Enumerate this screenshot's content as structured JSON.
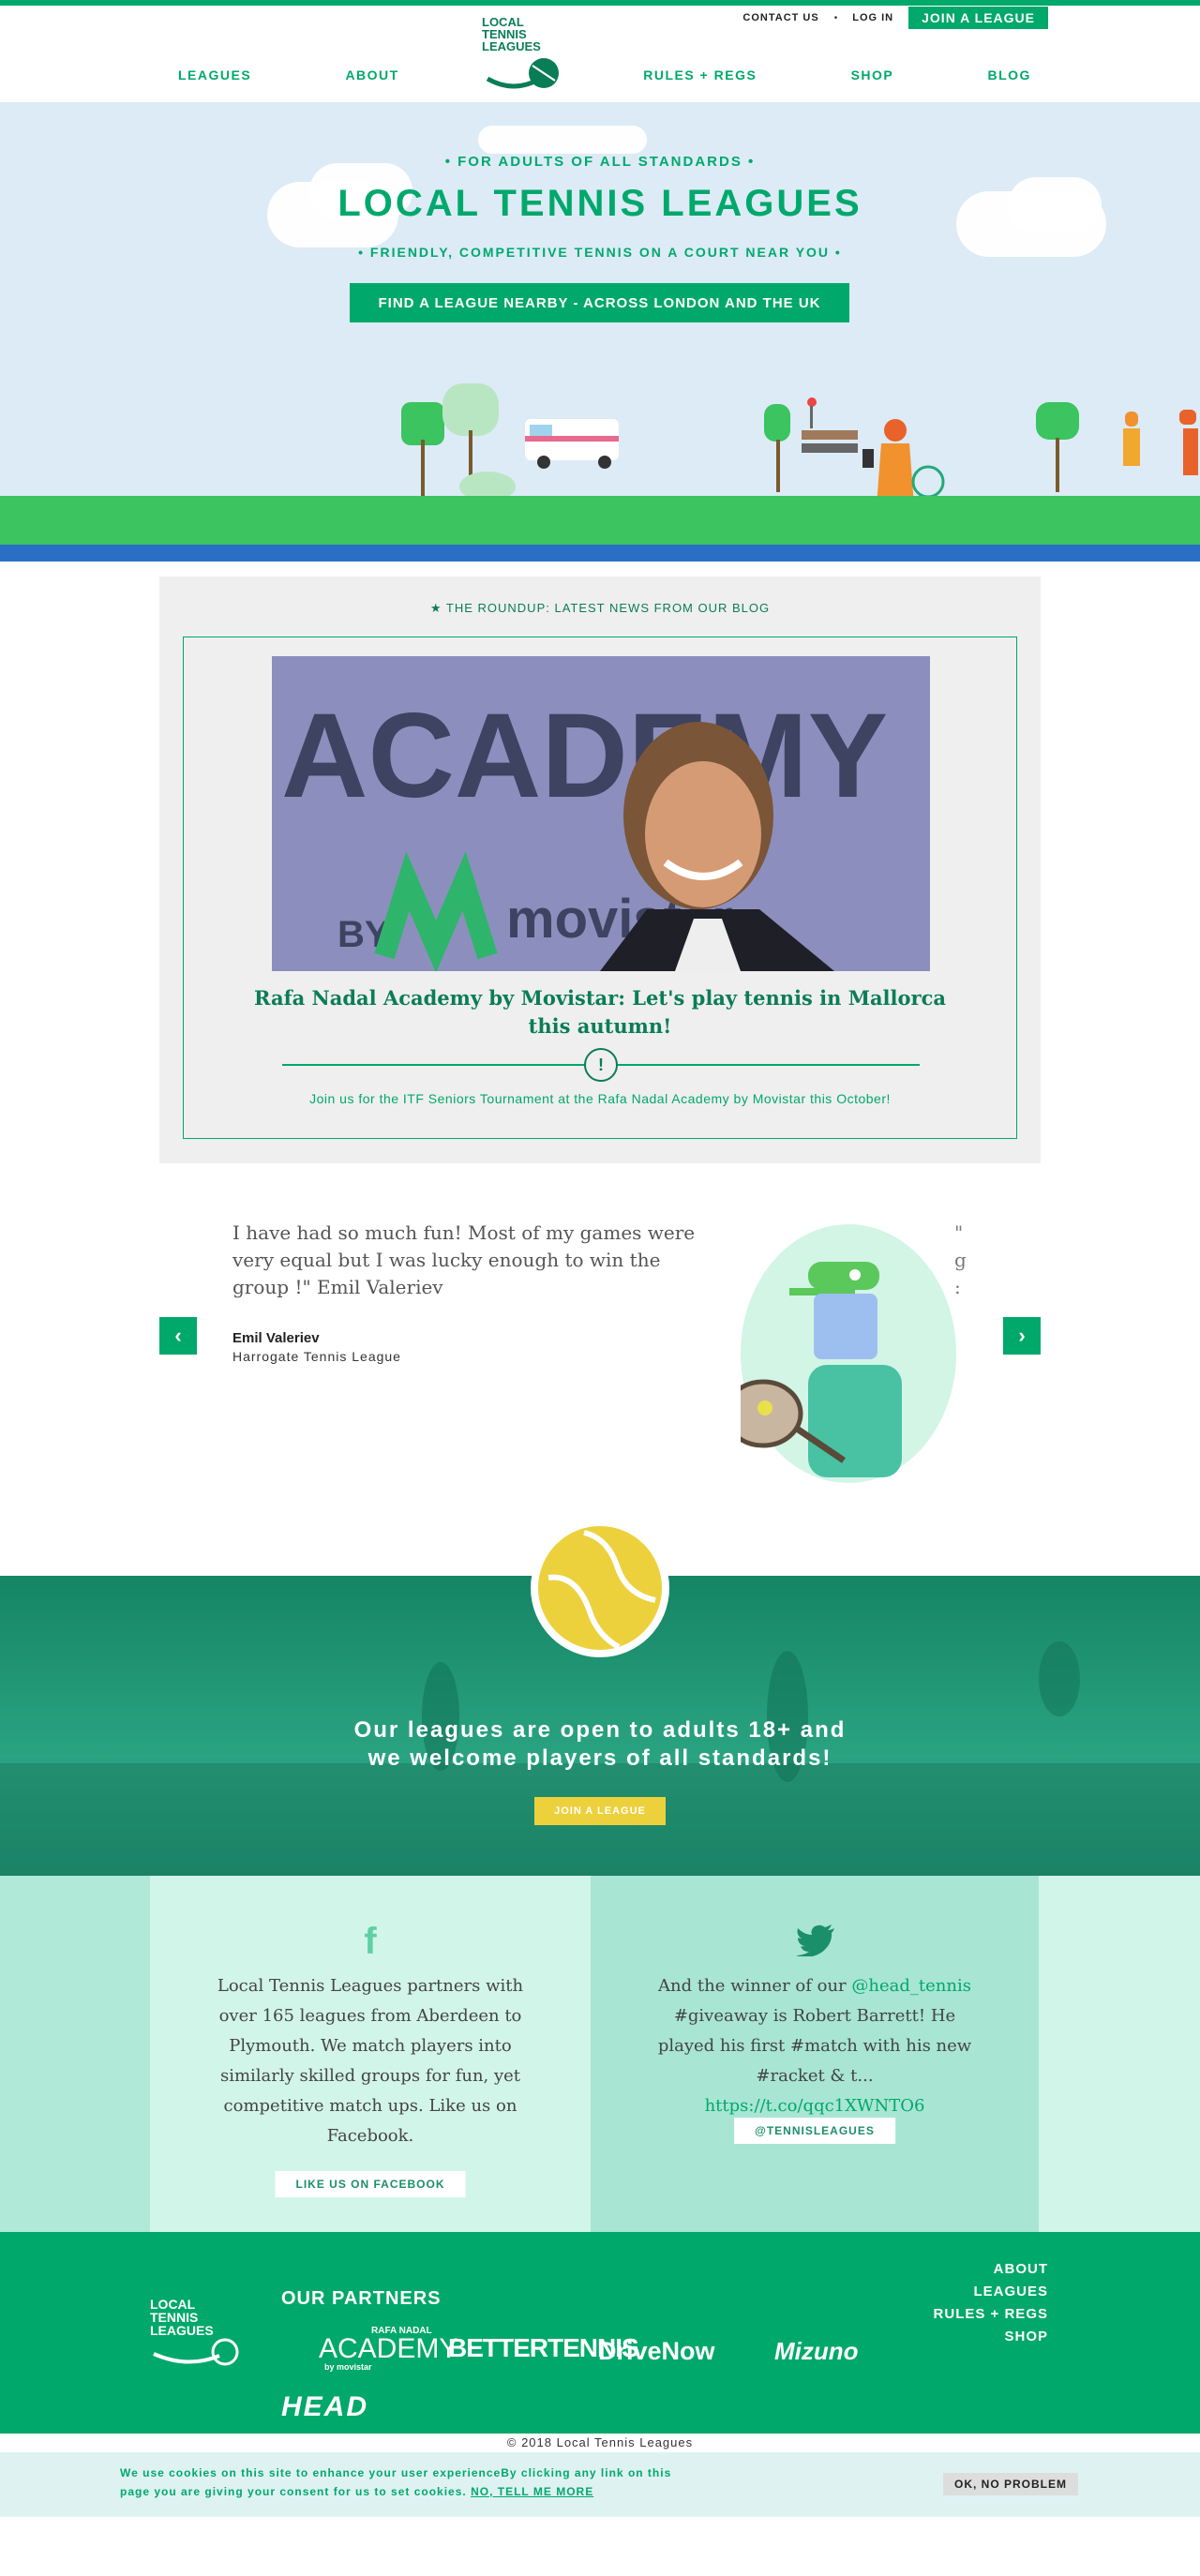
{
  "header": {
    "contact_label": "CONTACT US",
    "login_label": "LOG IN",
    "join_label": "JOIN A LEAGUE",
    "logo_lines": [
      "LOCAL",
      "TENNIS",
      "LEAGUES"
    ],
    "nav": [
      "LEAGUES",
      "ABOUT",
      "RULES + REGS",
      "SHOP",
      "BLOG"
    ]
  },
  "hero": {
    "kicker": "• FOR ADULTS OF ALL STANDARDS •",
    "title": "LOCAL TENNIS LEAGUES",
    "subtitle": "• FRIENDLY, COMPETITIVE TENNIS ON A COURT NEAR YOU •",
    "cta": "FIND A LEAGUE NEARBY - ACROSS LONDON AND THE UK"
  },
  "roundup": {
    "heading": "★ THE ROUNDUP: LATEST NEWS FROM OUR BLOG",
    "image_sign_text": "ACADEMY",
    "image_sign_by": "BY",
    "image_sign_brand": "movistar",
    "title": "Rafa Nadal Academy by Movistar: Let's play tennis in Mallorca this autumn!",
    "badge": "!",
    "excerpt": "Join us for the ITF Seniors Tournament at the Rafa Nadal Academy by Movistar this October!"
  },
  "testimonial": {
    "quote": "I have had so much fun! Most of my games were very equal but I was lucky enough to win the group !\" Emil Valeriev",
    "name": "Emil Valeriev",
    "league": "Harrogate Tennis League",
    "prev_arrow": "‹",
    "next_arrow": "›",
    "next_peek": "\"\ng\n:"
  },
  "callout": {
    "text_line1": "Our leagues are open to adults 18+ and",
    "text_line2": "we welcome players of all standards!",
    "button": "JOIN A LEAGUE"
  },
  "social": {
    "facebook_icon": "f",
    "facebook_text": "Local Tennis Leagues partners with over 165 leagues from Aberdeen to Plymouth. We match players into similarly skilled groups for fun, yet competitive match ups. Like us on Facebook.",
    "facebook_button": "LIKE US ON FACEBOOK",
    "twitter_text_before": "And the winner of our ",
    "twitter_handle_mention": "@head_tennis",
    "twitter_text_after": " #giveaway is Robert Barrett! He played his first #match with his new #racket & t... ",
    "twitter_link": "https://t.co/qqc1XWNTO6",
    "twitter_button": "@TENNISLEAGUES"
  },
  "footer": {
    "partners_title": "OUR PARTNERS",
    "logo_lines": [
      "LOCAL",
      "TENNIS",
      "LEAGUES"
    ],
    "partners": {
      "academy_top": "RAFA NADAL",
      "academy_main": "ACADEMY",
      "academy_by": "by movistar",
      "bettertennis": "BETTERTENNIS",
      "drivenow": "DriveNow",
      "mizuno": "Mizuno",
      "head": "HEAD"
    },
    "links": [
      "ABOUT",
      "LEAGUES",
      "RULES + REGS",
      "SHOP"
    ],
    "copyright": "© 2018 Local Tennis Leagues"
  },
  "cookie": {
    "text": "We use cookies on this site to enhance your user experienceBy clicking any link on this page you are giving your consent for us to set cookies. ",
    "more_link": "NO, TELL ME MORE",
    "ok_button": "OK, NO PROBLEM"
  },
  "colors": {
    "brand_green": "#00a86b",
    "dark_green": "#0b7d56",
    "sky": "#dcebf6",
    "ball_yellow": "#ecd13c"
  }
}
